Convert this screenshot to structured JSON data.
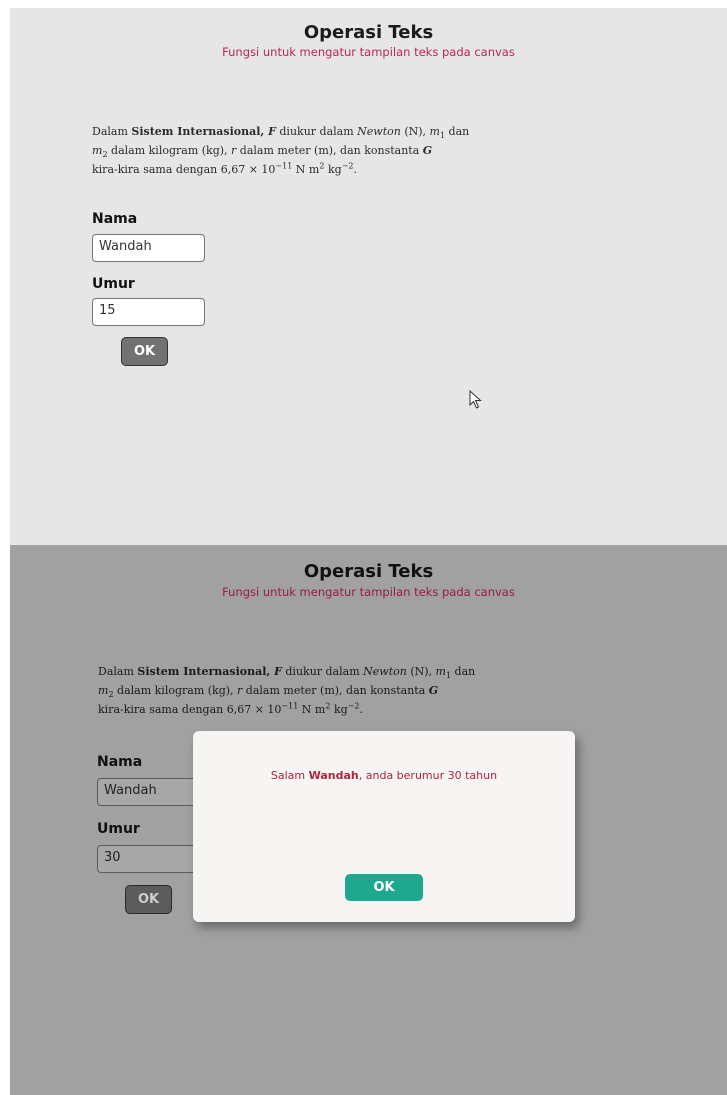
{
  "top": {
    "title": "Operasi Teks",
    "subtitle": "Fungsi untuk mengatur tampilan teks pada canvas",
    "paragraph": {
      "s1": "Dalam ",
      "bold1": "Sistem Internasional, ",
      "F": "F",
      "s2": " diukur dalam ",
      "newton": "Newton",
      "s3": " (N), ",
      "m": "m",
      "sub1": "1",
      "s4": " dan",
      "m2": "m",
      "sub2": "2",
      "s5": " dalam kilogram (kg), ",
      "r": "r",
      "s6": " dalam meter (m), dan konstanta ",
      "G": "G",
      "s7": "kira-kira sama dengan 6,67 × 10",
      "exp1": "−11",
      "s8": " N m",
      "exp2": "2",
      "s9": " kg",
      "exp3": "−2",
      "s10": "."
    },
    "nama_label": "Nama",
    "nama_value": "Wandah",
    "umur_label": "Umur",
    "umur_value": "15",
    "ok_label": "OK"
  },
  "bottom": {
    "title": "Operasi Teks",
    "subtitle": "Fungsi untuk mengatur tampilan teks pada canvas",
    "nama_label": "Nama",
    "nama_value": "Wandah",
    "umur_label": "Umur",
    "umur_value": "30",
    "ok_label": "OK",
    "dialog": {
      "msg_prefix": "Salam ",
      "msg_name": "Wandah",
      "msg_suffix": ", anda berumur 30 tahun",
      "ok_label": "OK"
    }
  },
  "colors": {
    "accent": "#c1235a",
    "dialog_ok": "#1ea88e"
  }
}
